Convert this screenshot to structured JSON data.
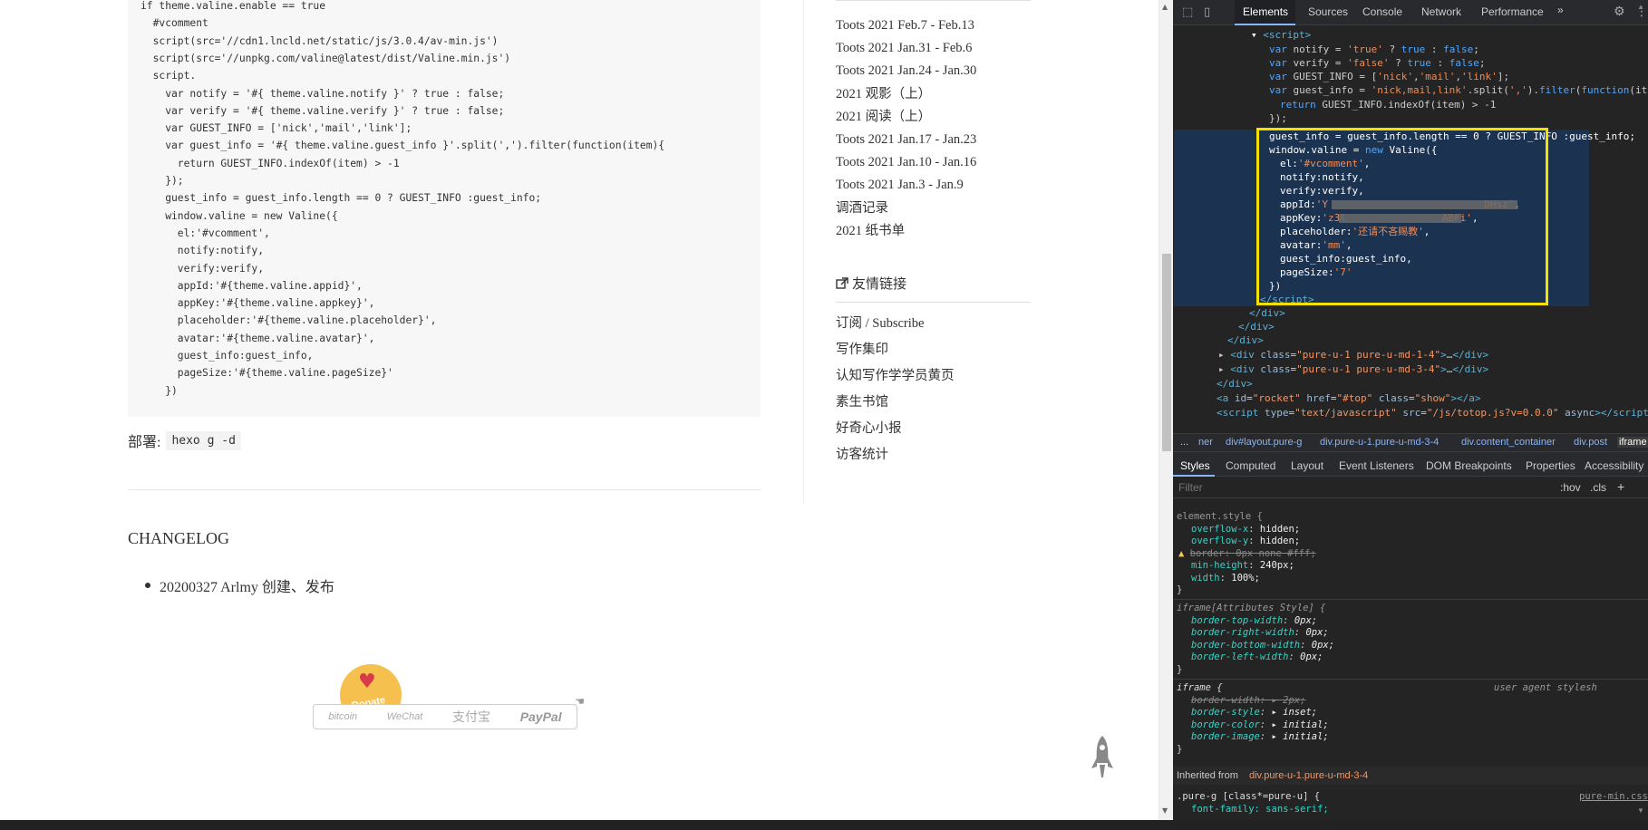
{
  "code_block": {
    "lines": [
      "if theme.valine.enable == true",
      "  #vcomment",
      "  script(src='//cdn1.lncld.net/static/js/3.0.4/av-min.js')",
      "  script(src='//unpkg.com/valine@latest/dist/Valine.min.js')",
      "  script.",
      "    var notify = '#{ theme.valine.notify }' ? true : false;",
      "    var verify = '#{ theme.valine.verify }' ? true : false;",
      "    var GUEST_INFO = ['nick','mail','link'];",
      "    var guest_info = '#{ theme.valine.guest_info }'.split(',').filter(function(item){",
      "      return GUEST_INFO.indexOf(item) > -1",
      "    });",
      "    guest_info = guest_info.length == 0 ? GUEST_INFO :guest_info;",
      "    window.valine = new Valine({",
      "      el:'#vcomment',",
      "      notify:notify,",
      "      verify:verify,",
      "      appId:'#{theme.valine.appid}',",
      "      appKey:'#{theme.valine.appkey}',",
      "      placeholder:'#{theme.valine.placeholder}',",
      "      avatar:'#{theme.valine.avatar}',",
      "      guest_info:guest_info,",
      "      pageSize:'#{theme.valine.pageSize}'",
      "    })"
    ]
  },
  "deploy": {
    "label": "部署:",
    "command": "hexo g -d"
  },
  "changelog": {
    "title": "CHANGELOG",
    "items": [
      "20200327 Arlmy 创建、发布"
    ]
  },
  "donate": {
    "label": "Donate",
    "methods": [
      "bitcoin",
      "WeChat",
      "支付宝",
      "PayPal"
    ]
  },
  "sidebar": {
    "recent_posts": [
      "Toots 2021 Feb.7 - Feb.13",
      "Toots 2021 Jan.31 - Feb.6",
      "Toots 2021 Jan.24 - Jan.30",
      "2021 观影（上）",
      "2021 阅读（上）",
      "Toots 2021 Jan.17 - Jan.23",
      "Toots 2021 Jan.10 - Jan.16",
      "Toots 2021 Jan.3 - Jan.9",
      "调酒记录",
      "2021 纸书单"
    ],
    "links_title": "友情链接",
    "links": [
      "订阅 / Subscribe",
      "写作集印",
      "认知写作学学员黄页",
      "素生书馆",
      "好奇心小报",
      "访客统计"
    ]
  },
  "devtools": {
    "tabs": [
      "Elements",
      "Sources",
      "Console",
      "Network",
      "Performance"
    ],
    "active_tab": "Elements",
    "more_tabs": "»",
    "breadcrumb": [
      "...",
      "ner",
      "div#layout.pure-g",
      "div.pure-u-1.pure-u-md-3-4",
      "div.content_container",
      "div.post",
      "iframe"
    ],
    "subtabs": [
      "Styles",
      "Computed",
      "Layout",
      "Event Listeners",
      "DOM Breakpoints",
      "Properties",
      "Accessibility"
    ],
    "active_subtab": "Styles",
    "filter_placeholder": "Filter",
    "hov": ":hov",
    "cls": ".cls",
    "add": "+",
    "element_style_selector": "element.style {",
    "iframe_attr_selector": "iframe[Attributes Style] {",
    "iframe_selector": "iframe {",
    "user_agent_label": "user agent stylesh",
    "inherited_label": "Inherited from",
    "inherited_from": "div.pure-u-1.pure-u-md-3-4",
    "pure_selector": ".pure-g [class*=pure-u] {",
    "pure_source": "pure-min.css",
    "pure_partial": "font-family: sans-serif;"
  },
  "colors": {
    "highlight_box": "#f5e000",
    "devtools_bg": "#242424",
    "tab_accent": "#8ab4f8",
    "code_bg": "#f7f7f7"
  }
}
